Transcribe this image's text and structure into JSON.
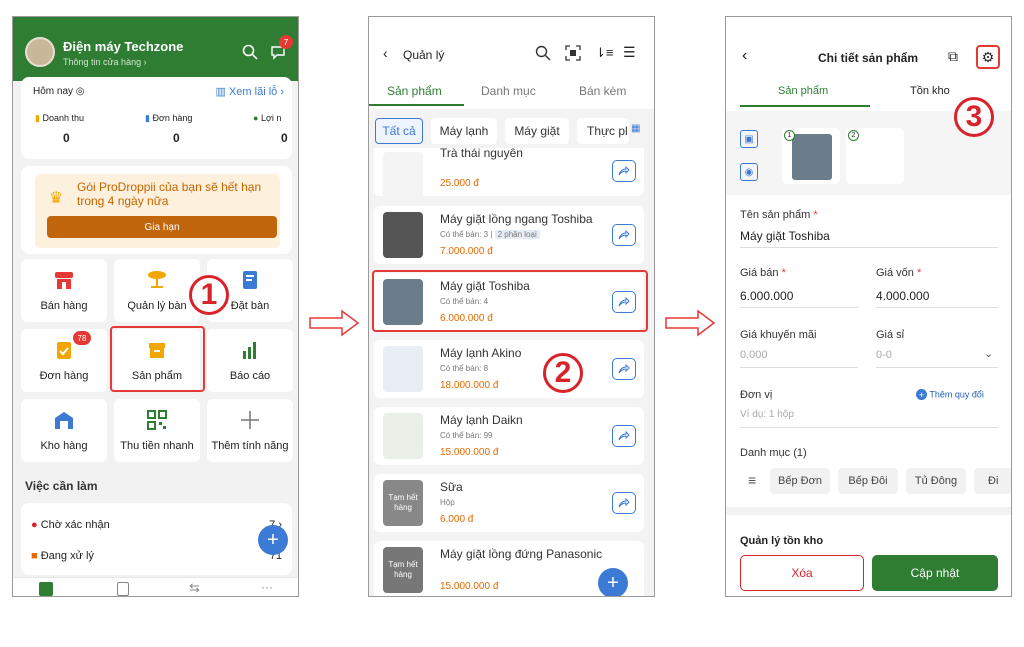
{
  "screen1": {
    "store_name": "Điện máy Techzone",
    "store_sub": "Thông tin cửa hàng ›",
    "notif_count": "7",
    "today_label": "Hôm nay",
    "profit_link": "Xem lãi lỗ ›",
    "stats": [
      {
        "label": "Doanh thu",
        "value": "0"
      },
      {
        "label": "Đơn hàng",
        "value": "0"
      },
      {
        "label": "Lợi n",
        "value": "0"
      }
    ],
    "promo_text_brand": "Gói ProDroppii",
    "promo_text_rest": " của bạn sẽ hết hạn trong 4 ngày nữa",
    "promo_button": "Gia hạn",
    "tiles": [
      {
        "label": "Bán hàng"
      },
      {
        "label": "Quản lý bàn"
      },
      {
        "label": "Đặt bàn"
      },
      {
        "label": "Đơn hàng",
        "badge": "78"
      },
      {
        "label": "Sản phẩm"
      },
      {
        "label": "Báo cáo"
      },
      {
        "label": "Kho hàng"
      },
      {
        "label": "Thu tiền nhanh"
      },
      {
        "label": "Thêm tính năng"
      }
    ],
    "todo_title": "Việc cần làm",
    "todo": [
      {
        "label": "Chờ xác nhận",
        "count": "7 ›"
      },
      {
        "label": "Đang xử lý",
        "count": "71"
      }
    ],
    "callout": "1"
  },
  "screen2": {
    "title": "Quản lý",
    "tabs": [
      "Sản phẩm",
      "Danh mục",
      "Bán kèm"
    ],
    "chips": [
      "Tất cả",
      "Máy lạnh",
      "Máy giặt",
      "Thực pl"
    ],
    "products": [
      {
        "name": "Trà thái nguyên",
        "sub": "",
        "price": "25.000 đ"
      },
      {
        "name": "Máy giặt lồng ngang Toshiba",
        "sub": "Có thể bán: 3  |",
        "tag": "2 phân loại",
        "price": "7.000.000 đ"
      },
      {
        "name": "Máy giặt Toshiba",
        "sub": "Có thể bán: 4",
        "price": "6.000.000 đ"
      },
      {
        "name": "Máy lạnh Akino",
        "sub": "Có thể bán: 8",
        "price": "18.000.000 đ"
      },
      {
        "name": "Máy lạnh Daikn",
        "sub": "Có thể bán: 99",
        "price": "15.000.000 đ"
      },
      {
        "name": "Sữa",
        "sub": "Hộp",
        "price": "6.000 đ",
        "overlay": "Tạm hết hàng"
      },
      {
        "name": "Máy giặt lồng đứng Panasonic",
        "sub": "",
        "price": "15.000.000 đ",
        "overlay": "Tạm hết hàng"
      }
    ],
    "callout": "2"
  },
  "screen3": {
    "title": "Chi tiết sản phẩm",
    "tabs": [
      "Sản phẩm",
      "Tồn kho"
    ],
    "img_numbers": [
      "1",
      "2"
    ],
    "name_label": "Tên sản phẩm",
    "name_value": "Máy giặt Toshiba",
    "price_label": "Giá bán",
    "price_value": "6.000.000",
    "cost_label": "Giá vốn",
    "cost_value": "4.000.000",
    "promo_label": "Giá khuyến mãi",
    "promo_placeholder": "0.000",
    "wholesale_label": "Giá sỉ",
    "wholesale_placeholder": "0-0",
    "unit_label": "Đơn vị",
    "unit_placeholder": "Ví dụ: 1 hộp",
    "add_conversion": "Thêm quy đổi",
    "category_label": "Danh mục (1)",
    "categories": [
      "Bếp Đơn",
      "Bếp Đôi",
      "Tủ Đông",
      "Đi"
    ],
    "inventory_title": "Quản lý tồn kho",
    "delete_button": "Xóa",
    "update_button": "Cập nhật",
    "callout": "3"
  },
  "colors": {
    "green": "#2e7d32",
    "red": "#d8232a",
    "orange": "#e66a00",
    "blue": "#3b7bd5"
  }
}
